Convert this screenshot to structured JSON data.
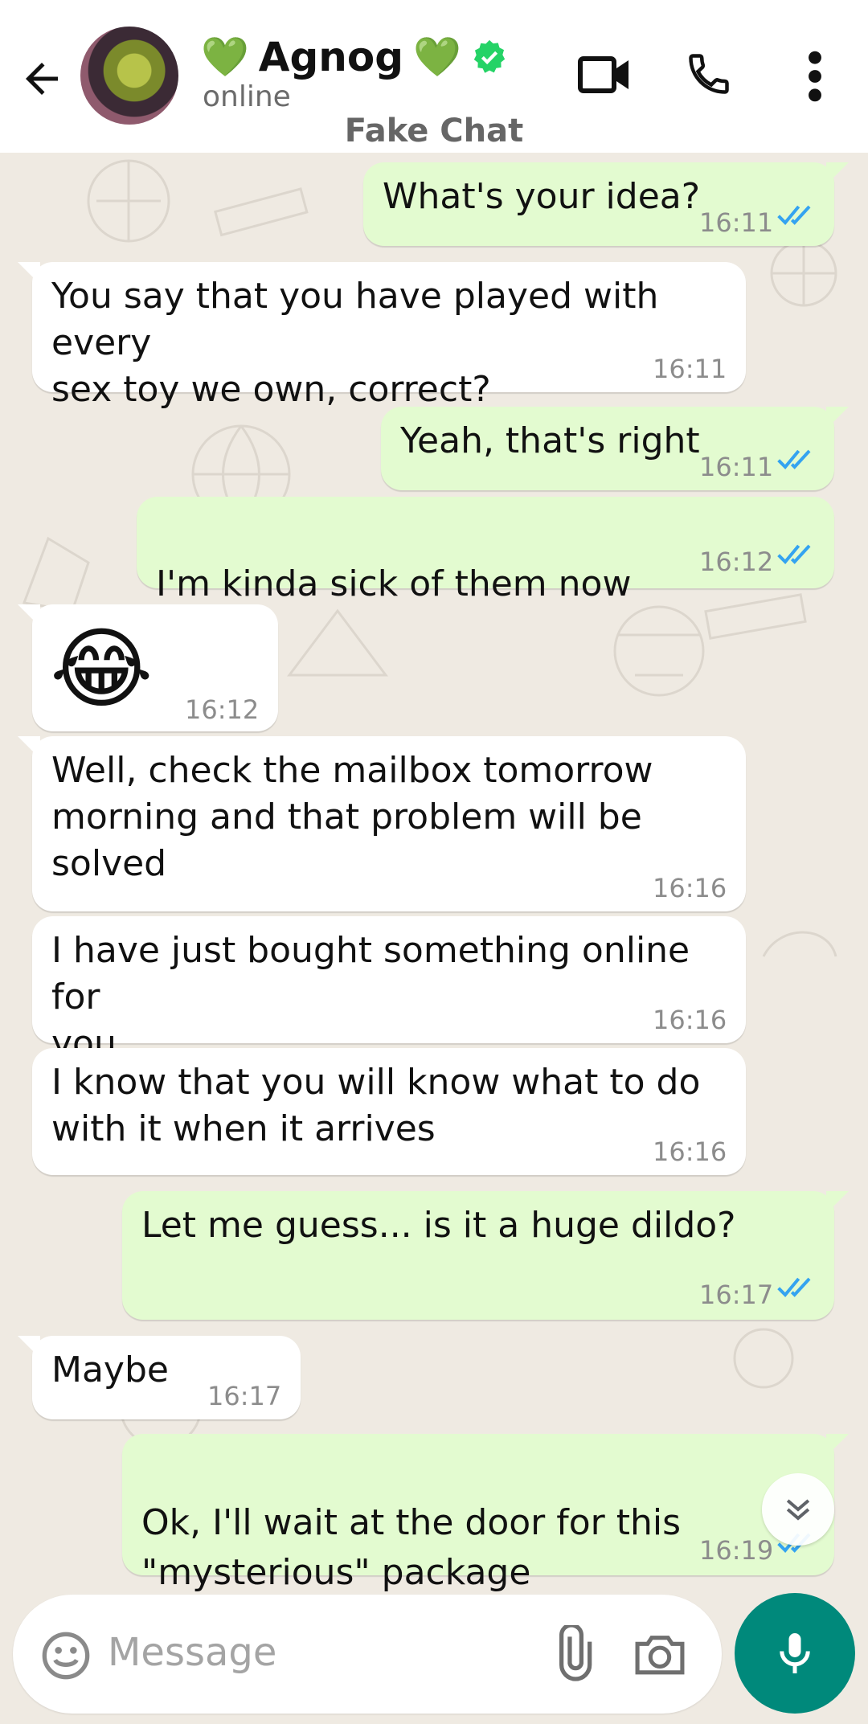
{
  "header": {
    "heart_left": "💚",
    "name": "Agnog",
    "heart_right": "💚",
    "status": "online",
    "subtitle": "Fake Chat"
  },
  "messages": [
    {
      "dir": "out",
      "text": "What's your idea?",
      "time": "16:11",
      "read": true
    },
    {
      "dir": "in",
      "text": "You say that you have played with every\nsex toy we own, correct?",
      "time": "16:11"
    },
    {
      "dir": "out",
      "text": "Yeah, that's right",
      "time": "16:11",
      "read": true
    },
    {
      "dir": "out",
      "text": "I'm kinda sick of them now",
      "emoji": "😂",
      "time": "16:12",
      "read": true
    },
    {
      "dir": "in",
      "emoji": "😂",
      "time": "16:12"
    },
    {
      "dir": "in",
      "text": "Well, check the mailbox tomorrow\nmorning and that problem will be\nsolved",
      "time": "16:16"
    },
    {
      "dir": "in",
      "text": "I have just bought something online for\nyou",
      "time": "16:16"
    },
    {
      "dir": "in",
      "text": "I know that you will know what to do\nwith it when it arrives",
      "time": "16:16"
    },
    {
      "dir": "out",
      "text": "Let me guess... is it a huge dildo?",
      "time": "16:17",
      "read": true
    },
    {
      "dir": "in",
      "text": "Maybe",
      "time": "16:17"
    },
    {
      "dir": "out",
      "text": "Ok, I'll wait at the door for this\n\"mysterious\" package",
      "emoji": "🙄",
      "time": "16:19",
      "read": true
    }
  ],
  "composer": {
    "placeholder": "Message"
  },
  "colors": {
    "outgoing_bubble": "#e3fbd0",
    "incoming_bubble": "#ffffff",
    "chat_background": "#efeae2",
    "read_ticks": "#34a3f0",
    "mic_button": "#00897b",
    "verified_badge": "#25d366"
  },
  "icons": [
    "back-arrow-icon",
    "verified-icon",
    "video-call-icon",
    "phone-icon",
    "menu-icon",
    "scroll-down-icon",
    "smiley-icon",
    "attach-icon",
    "camera-icon",
    "mic-icon"
  ]
}
